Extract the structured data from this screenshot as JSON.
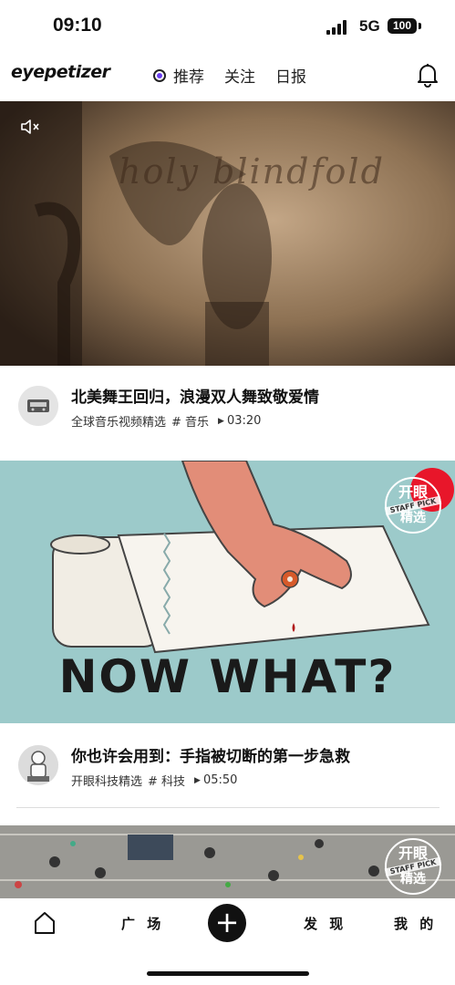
{
  "status": {
    "time": "09:10",
    "network": "5G",
    "battery": "100"
  },
  "header": {
    "logo": "eyepetizer",
    "tabs": [
      {
        "label": "推荐",
        "active": true
      },
      {
        "label": "关注",
        "active": false
      },
      {
        "label": "日报",
        "active": false
      }
    ],
    "accent": "#6a3df0"
  },
  "feed": [
    {
      "video_overlay": "holy blindfold",
      "title": "北美舞王回归，浪漫双人舞致敬爱情",
      "channel": "全球音乐视频精选",
      "tag": "# 音乐",
      "duration": "03:20"
    },
    {
      "video_overlay": "NOW WHAT?",
      "badge": {
        "line1": "开眼",
        "line2": "STAFF PICK",
        "line3": "精选"
      },
      "title": "你也许会用到：手指被切断的第一步急救",
      "channel": "开眼科技精选",
      "tag": "# 科技",
      "duration": "05:50"
    },
    {
      "badge": {
        "line1": "开眼",
        "line2": "STAFF PICK",
        "line3": "精选"
      }
    }
  ],
  "bottom_nav": {
    "square": "广 场",
    "discover": "发 现",
    "mine": "我 的"
  }
}
